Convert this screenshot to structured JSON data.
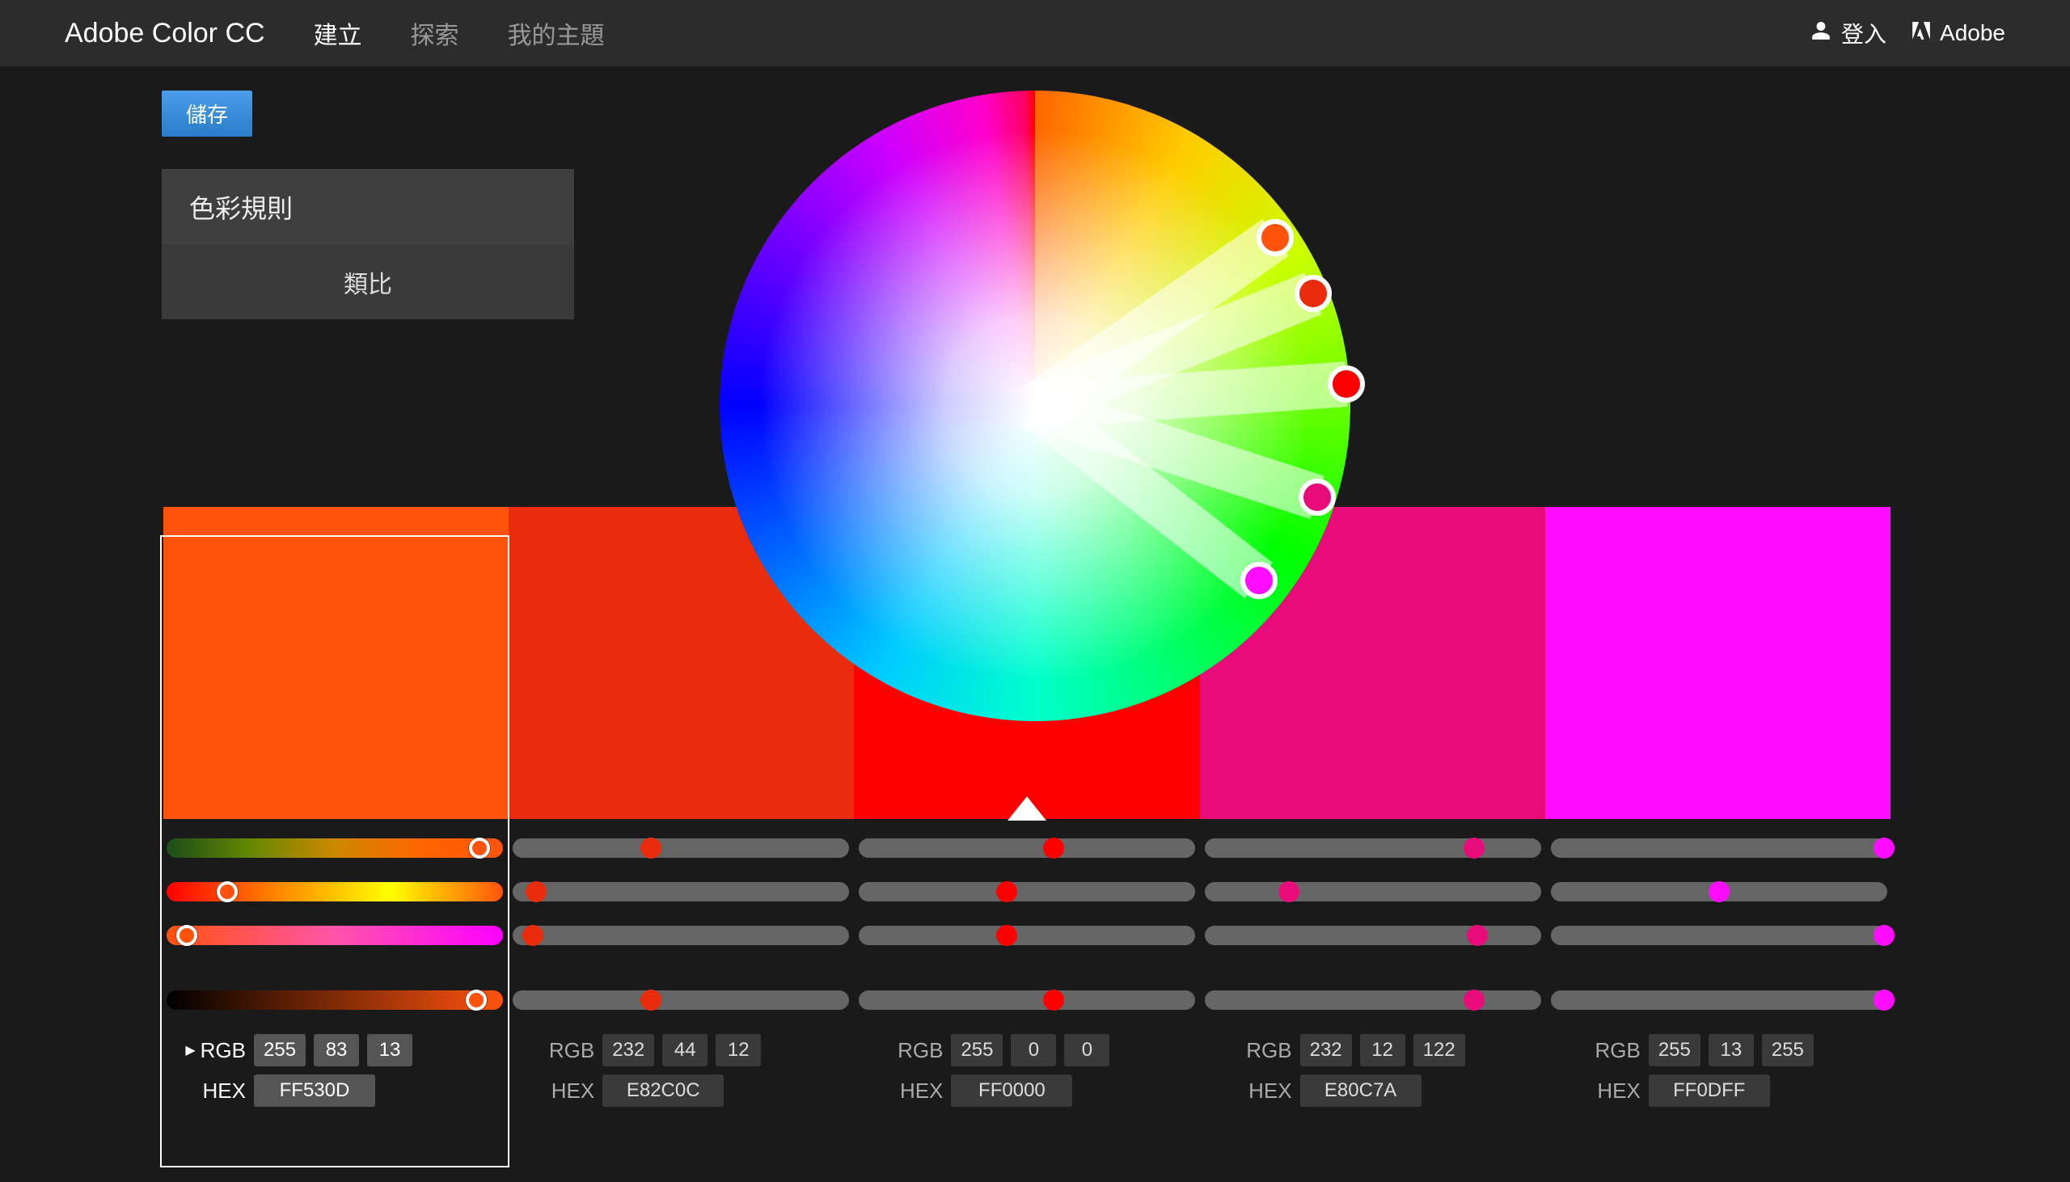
{
  "header": {
    "brand": "Adobe Color CC",
    "nav": [
      "建立",
      "探索",
      "我的主題"
    ],
    "active_nav_index": 0,
    "login": "登入",
    "adobe": "Adobe"
  },
  "save_label": "儲存",
  "rules": {
    "title": "色彩規則",
    "selected": "類比"
  },
  "swatches": [
    {
      "hex": "FF530D",
      "rgb": [
        255,
        83,
        13
      ],
      "selected": true,
      "base": false
    },
    {
      "hex": "E82C0C",
      "rgb": [
        232,
        44,
        12
      ],
      "selected": false,
      "base": false
    },
    {
      "hex": "FF0000",
      "rgb": [
        255,
        0,
        0
      ],
      "selected": false,
      "base": true
    },
    {
      "hex": "E80C7A",
      "rgb": [
        232,
        12,
        122
      ],
      "selected": false,
      "base": false
    },
    {
      "hex": "FF0DFF",
      "rgb": [
        255,
        13,
        255
      ],
      "selected": false,
      "base": false
    }
  ],
  "value_labels": {
    "rgb": "RGB",
    "hex": "HEX"
  },
  "wheel_handles_deg_r": [
    {
      "deg": 55,
      "r": 0.93
    },
    {
      "deg": 68,
      "r": 0.95
    },
    {
      "deg": 86,
      "r": 0.99
    },
    {
      "deg": 108,
      "r": 0.94
    },
    {
      "deg": 128,
      "r": 0.9
    }
  ],
  "slider_groups": [
    {
      "type": "hue",
      "dots_pct": [
        93,
        41,
        58,
        80,
        99
      ]
    },
    {
      "type": "sat",
      "dots_pct": [
        18,
        7,
        44,
        25,
        50
      ]
    },
    {
      "type": "light",
      "dots_pct": [
        6,
        6,
        44,
        81,
        99
      ]
    },
    {
      "type": "value",
      "dots_pct": [
        92,
        41,
        58,
        80,
        99
      ]
    }
  ]
}
